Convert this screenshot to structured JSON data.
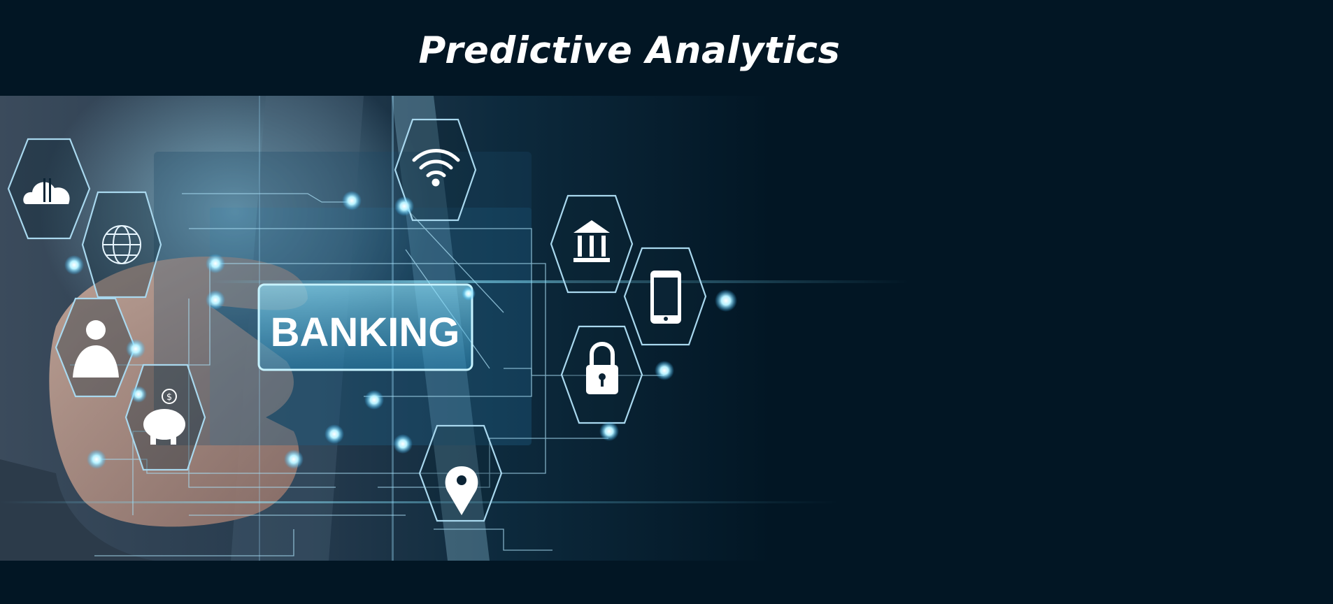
{
  "slide": {
    "title": "Predictive Analytics",
    "banner_label": "BANKING"
  },
  "icons": [
    "cloud-transfer-icon",
    "globe-icon",
    "user-icon",
    "piggy-bank-icon",
    "wifi-icon",
    "bank-building-icon",
    "smartphone-icon",
    "padlock-icon",
    "location-pin-icon"
  ],
  "colors": {
    "background": "#021624",
    "glow": "#7fe3ff",
    "hexagon_stroke": "#9fd4ee",
    "text": "#ffffff"
  }
}
